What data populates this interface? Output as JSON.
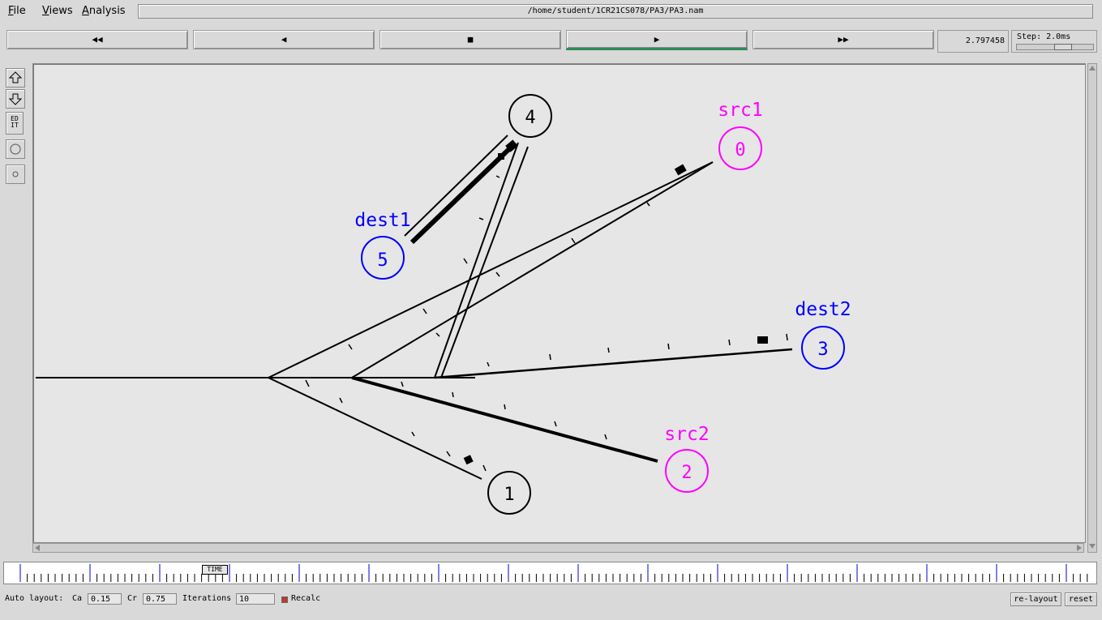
{
  "menu": {
    "file": {
      "accel": "F",
      "rest": "ile"
    },
    "views": {
      "accel": "V",
      "rest": "iews"
    },
    "analysis": {
      "accel": "A",
      "rest": "nalysis"
    }
  },
  "window_title": "/home/student/1CR21CS078/PA3/PA3.nam",
  "toolbar": {
    "rewind": "◀◀",
    "back": "◀",
    "stop": "■",
    "play": "▶",
    "fast_forward": "▶▶"
  },
  "time_display": "2.797458",
  "step_label": "Step: 2.0ms",
  "tools": {
    "edit_label_1": "ED",
    "edit_label_2": "IT"
  },
  "nodes": [
    {
      "id": "0",
      "label": "src1",
      "color": "#ff00ff"
    },
    {
      "id": "1",
      "label": "",
      "color": "#000000"
    },
    {
      "id": "2",
      "label": "src2",
      "color": "#ff00ff"
    },
    {
      "id": "3",
      "label": "dest2",
      "color": "#0000ff"
    },
    {
      "id": "4",
      "label": "",
      "color": "#000000"
    },
    {
      "id": "5",
      "label": "dest1",
      "color": "#0000ff"
    }
  ],
  "timeline_marker": "TIME",
  "auto_layout": {
    "label": "Auto layout:",
    "ca_label": "Ca",
    "ca_value": "0.15",
    "cr_label": "Cr",
    "cr_value": "0.75",
    "iterations_label": "Iterations",
    "iterations_value": "10",
    "recalc_label": "Recalc",
    "relayout_button": "re-layout",
    "reset_button": "reset"
  }
}
